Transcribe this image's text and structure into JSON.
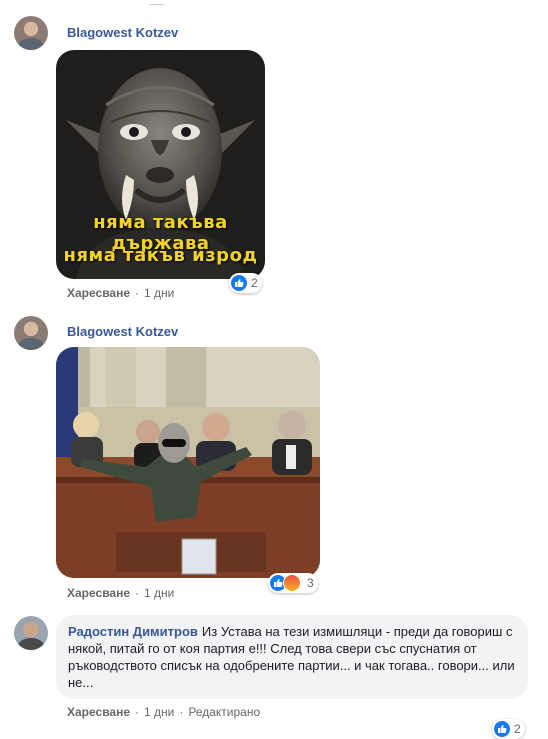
{
  "comments": [
    {
      "author": "Blagowest Kotzev",
      "image": {
        "caption_line1": "няма такъва държава",
        "caption_line2": "няма такъв изрод"
      },
      "actions": {
        "like": "Харесване",
        "time": "1 дни"
      },
      "reactions": {
        "count": "2",
        "icons": [
          "like-icon"
        ]
      }
    },
    {
      "author": "Blagowest Kotzev",
      "actions": {
        "like": "Харесване",
        "time": "1 дни"
      },
      "reactions": {
        "count": "3",
        "icons": [
          "like-icon",
          "angry-icon"
        ]
      }
    },
    {
      "author": "Радостин Димитров",
      "text": "Из Устава на тези измишляци - преди да говориш с някой, питай го от коя партия е!!! След това свери със спуснатия от ръководството списък на одобрените партии... и чак тогава.. говори... или не...",
      "actions": {
        "like": "Харесване",
        "time": "1 дни",
        "edited": "Редактирано"
      },
      "reactions": {
        "count": "2",
        "icons": [
          "like-icon"
        ]
      }
    }
  ],
  "colors": {
    "link": "#385898",
    "meta": "#65676b",
    "bubble": "#f2f3f5",
    "like": "#1877f2"
  }
}
